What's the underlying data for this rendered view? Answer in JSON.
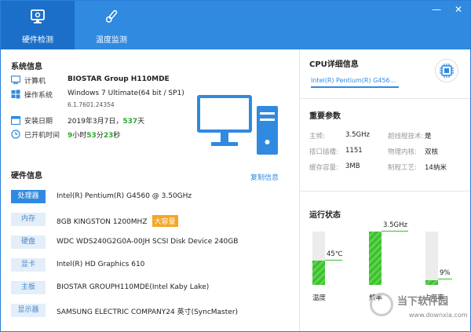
{
  "tabs": [
    {
      "label": "硬件检测",
      "icon": "monitor-icon",
      "active": true
    },
    {
      "label": "温度监测",
      "icon": "thermometer-icon",
      "active": false
    }
  ],
  "window_controls": {
    "minimize": "—",
    "close": "✕"
  },
  "system_info": {
    "title": "系统信息",
    "computer_label": "计算机",
    "computer_value": "BIOSTAR Group H110MDE",
    "os_label": "操作系统",
    "os_value": "Windows 7 Ultimate(64 bit / SP1)",
    "os_build": "6.1.7601.24354",
    "install_label": "安装日期",
    "install_date": "2019年3月7日，",
    "install_days": "537",
    "install_days_unit": "天",
    "uptime_label": "已开机时间",
    "uptime_h": "9",
    "uptime_h_unit": "小时",
    "uptime_m": "53",
    "uptime_m_unit": "分",
    "uptime_s": "23",
    "uptime_s_unit": "秒"
  },
  "hardware_info": {
    "title": "硬件信息",
    "copy_link": "复制信息",
    "rows": [
      {
        "tag": "处理器",
        "value": "Intel(R) Pentium(R) G4560 @ 3.50GHz",
        "active": true
      },
      {
        "tag": "内存",
        "value": "8GB KINGSTON  1200MHZ",
        "badge": "大容量"
      },
      {
        "tag": "硬盘",
        "value": "WDC WDS240G2G0A-00JH SCSI Disk Device 240GB"
      },
      {
        "tag": "显卡",
        "value": "Intel(R) HD Graphics 610"
      },
      {
        "tag": "主板",
        "value": "BIOSTAR GROUPH110MDE(Intel Kaby Lake)"
      },
      {
        "tag": "显示器",
        "value": "SAMSUNG ELECTRIC COMPANY24 英寸(SyncMaster)"
      }
    ]
  },
  "cpu_detail": {
    "title": "CPU详细信息",
    "selected": "Intel(R) Pentium(R) G456..."
  },
  "params": {
    "title": "重要参数",
    "items": [
      {
        "label": "主频:",
        "value": "3.5GHz"
      },
      {
        "label": "超线程技术:",
        "value": "是"
      },
      {
        "label": "接口插槽:",
        "value": "1151"
      },
      {
        "label": "物理内核:",
        "value": "双核"
      },
      {
        "label": "缓存容量:",
        "value": "3MB"
      },
      {
        "label": "制程工艺:",
        "value": "14纳米"
      }
    ]
  },
  "status": {
    "title": "运行状态",
    "gauges": [
      {
        "label": "温度",
        "value": "45℃",
        "fraction": 0.45
      },
      {
        "label": "频率",
        "value": "3.5GHz",
        "fraction": 1.0
      },
      {
        "label": "占用率",
        "value": "9%",
        "fraction": 0.09
      }
    ]
  },
  "watermark": {
    "brand": "当下软件园",
    "url": "www.downxia.com"
  },
  "colors": {
    "accent": "#2f8ae0",
    "active_tab": "#1c6fc8",
    "green": "#3bbf2f",
    "badge": "#f5a623"
  }
}
